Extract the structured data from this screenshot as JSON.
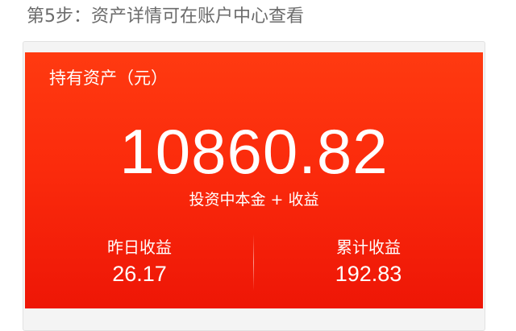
{
  "step": {
    "title": "第5步：资产详情可在账户中心查看"
  },
  "asset_card": {
    "label": "持有资产（元）",
    "total_amount": "10860.82",
    "amount_caption": "投资中本金 + 收益",
    "yesterday": {
      "label": "昨日收益",
      "value": "26.17"
    },
    "cumulative": {
      "label": "累计收益",
      "value": "192.83"
    }
  },
  "colors": {
    "card_top": "#ff3a10",
    "card_bottom": "#ee1606",
    "title_text": "#6b6b6b"
  }
}
